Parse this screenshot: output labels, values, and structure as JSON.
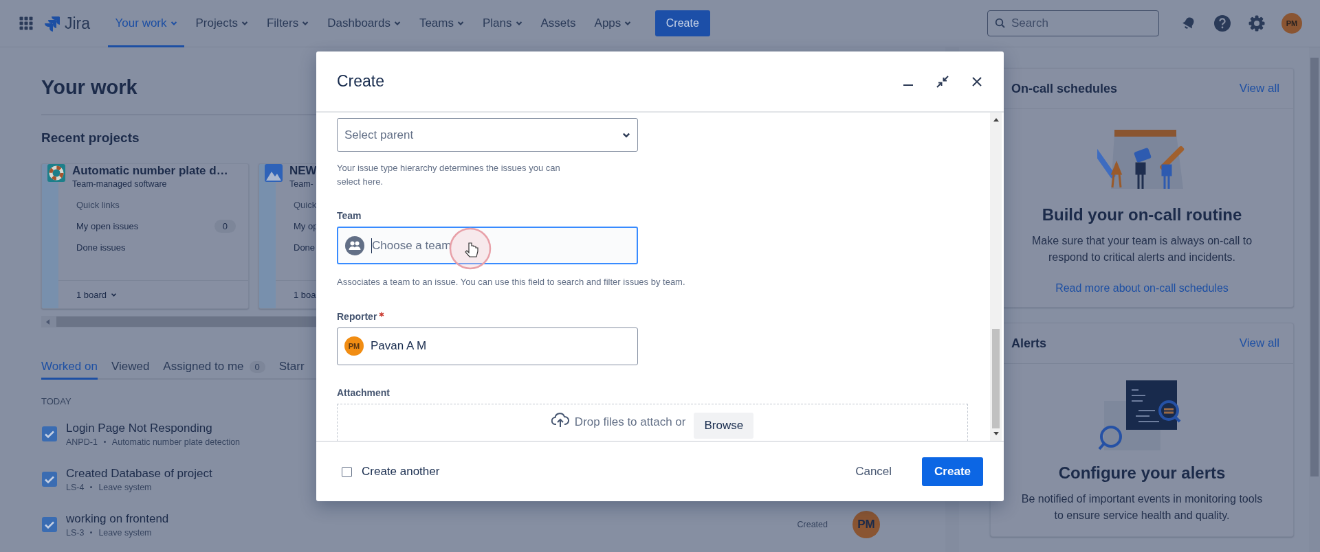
{
  "top_nav": {
    "logo": "Jira",
    "items": [
      {
        "label": "Your work",
        "selected": true,
        "dropdown": true
      },
      {
        "label": "Projects",
        "selected": false,
        "dropdown": true
      },
      {
        "label": "Filters",
        "selected": false,
        "dropdown": true
      },
      {
        "label": "Dashboards",
        "selected": false,
        "dropdown": true
      },
      {
        "label": "Teams",
        "selected": false,
        "dropdown": true
      },
      {
        "label": "Plans",
        "selected": false,
        "dropdown": true
      },
      {
        "label": "Assets",
        "selected": false,
        "dropdown": false
      },
      {
        "label": "Apps",
        "selected": false,
        "dropdown": true
      }
    ],
    "create_button": "Create",
    "search": {
      "placeholder": "Search"
    },
    "avatar": "PM"
  },
  "main": {
    "title": "Your work",
    "recent_projects": {
      "title": "Recent projects",
      "cards": [
        {
          "name": "Automatic number plate d…",
          "type": "Team-managed software",
          "quick_links": "Quick links",
          "links": [
            {
              "label": "My open issues",
              "count": "0"
            },
            {
              "label": "Done issues"
            }
          ],
          "boards": "1 board"
        },
        {
          "name": "NEW",
          "type": "Team-",
          "quick_links": "Quick",
          "links": [
            {
              "label": "My op"
            },
            {
              "label": "Done"
            }
          ],
          "boards": "1 boa"
        }
      ]
    },
    "tabs": [
      {
        "label": "Worked on",
        "selected": true
      },
      {
        "label": "Viewed",
        "selected": false
      },
      {
        "label": "Assigned to me",
        "count": "0",
        "selected": false
      },
      {
        "label": "Starr",
        "selected": false
      }
    ],
    "section": "TODAY",
    "issues": [
      {
        "title": "Login Page Not Responding",
        "key": "ANPD-1",
        "project": "Automatic number plate detection"
      },
      {
        "title": "Created Database of project",
        "key": "LS-4",
        "project": "Leave system"
      },
      {
        "title": "working on frontend",
        "key": "LS-3",
        "project": "Leave system",
        "action": "Created",
        "avatar": "PM"
      }
    ]
  },
  "side_panels": [
    {
      "title": "On-call schedules",
      "link": "View all",
      "kind": "calendar",
      "heading": "Build your on-call routine",
      "text": "Make sure that your team is always on-call to respond to critical alerts and incidents.",
      "more_link": "Read more about on-call schedules"
    },
    {
      "title": "Alerts",
      "link": "View all",
      "kind": "code",
      "heading": "Configure your alerts",
      "text": "Be notified of important events in monitoring tools to ensure service health and quality."
    }
  ],
  "modal": {
    "title": "Create",
    "fields": [
      {
        "kind": "select",
        "placeholder": "Select parent",
        "help": "Your issue type hierarchy determines the issues you can select here."
      },
      {
        "kind": "team",
        "label": "Team",
        "placeholder": "Choose a team",
        "focused": true,
        "help": "Associates a team to an issue. You can use this field to search and filter issues by team."
      },
      {
        "kind": "user",
        "label": "Reporter",
        "required": true,
        "value": "Pavan A M",
        "avatar": "PM"
      },
      {
        "kind": "attachment",
        "label": "Attachment",
        "text": "Drop files to attach or",
        "button": "Browse"
      }
    ],
    "footer": {
      "create_another": {
        "label": "Create another",
        "checked": false
      },
      "cancel": "Cancel",
      "submit": "Create"
    }
  }
}
